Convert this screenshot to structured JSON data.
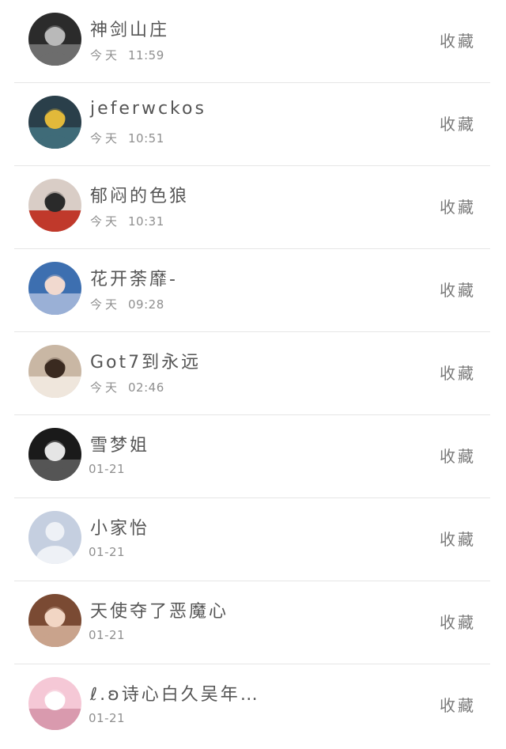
{
  "action_label": "收藏",
  "items": [
    {
      "name": "神剑山庄",
      "day": "今天",
      "time": "11:59",
      "avatar": "bald-man-photo-icon",
      "colors": [
        "#2b2b2b",
        "#b9b9b9",
        "#6d6d6d"
      ]
    },
    {
      "name": "jeferwckos",
      "day": "今天",
      "time": "10:51",
      "avatar": "person-yellow-jacket-photo-icon",
      "colors": [
        "#2a3f4a",
        "#e2b93a",
        "#3f6b78"
      ]
    },
    {
      "name": "郁闷的色狼",
      "day": "今天",
      "time": "10:31",
      "avatar": "meme-photo-icon",
      "colors": [
        "#d9cdc6",
        "#2a2a2a",
        "#c0392b"
      ]
    },
    {
      "name": "花开荼靡-",
      "day": "今天",
      "time": "09:28",
      "avatar": "boy-glasses-photo-icon",
      "colors": [
        "#3d6fb0",
        "#f1d9cf",
        "#9ab0d6"
      ]
    },
    {
      "name": "Got7到永远",
      "day": "今天",
      "time": "02:46",
      "avatar": "young-man-photo-icon",
      "colors": [
        "#c9b7a4",
        "#3a2a20",
        "#efe6dc"
      ]
    },
    {
      "name": "雪梦姐",
      "day": "",
      "time": "01-21",
      "avatar": "dark-figure-photo-icon",
      "colors": [
        "#1a1a1a",
        "#e5e5e5",
        "#555555"
      ]
    },
    {
      "name": "小家怡",
      "day": "",
      "time": "01-21",
      "avatar": "default-user-icon",
      "colors": [
        "#c5cfe0",
        "#eef1f6",
        "#aebad0"
      ]
    },
    {
      "name": "天使夺了恶魔心",
      "day": "",
      "time": "01-21",
      "avatar": "boy-portrait-photo-icon",
      "colors": [
        "#7a4a33",
        "#f2d6c4",
        "#c9a38c"
      ]
    },
    {
      "name": "ℓ.ʚ诗心白久吴年…",
      "day": "",
      "time": "01-21",
      "avatar": "girl-pink-photo-icon",
      "colors": [
        "#f5c8d6",
        "#ffffff",
        "#d99aae"
      ]
    }
  ]
}
